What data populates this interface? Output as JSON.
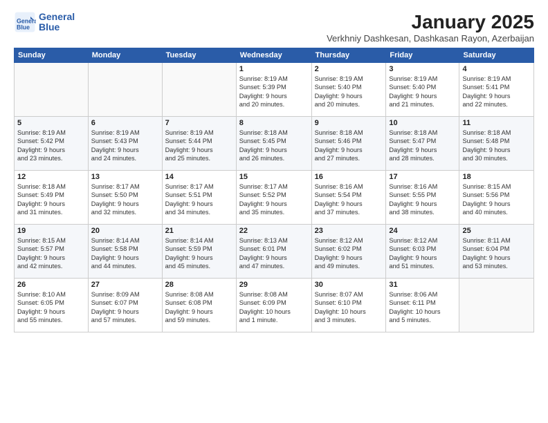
{
  "logo": {
    "line1": "General",
    "line2": "Blue"
  },
  "title": "January 2025",
  "location": "Verkhniy Dashkesan, Dashkasan Rayon, Azerbaijan",
  "weekdays": [
    "Sunday",
    "Monday",
    "Tuesday",
    "Wednesday",
    "Thursday",
    "Friday",
    "Saturday"
  ],
  "weeks": [
    [
      {
        "day": "",
        "info": ""
      },
      {
        "day": "",
        "info": ""
      },
      {
        "day": "",
        "info": ""
      },
      {
        "day": "1",
        "info": "Sunrise: 8:19 AM\nSunset: 5:39 PM\nDaylight: 9 hours\nand 20 minutes."
      },
      {
        "day": "2",
        "info": "Sunrise: 8:19 AM\nSunset: 5:40 PM\nDaylight: 9 hours\nand 20 minutes."
      },
      {
        "day": "3",
        "info": "Sunrise: 8:19 AM\nSunset: 5:40 PM\nDaylight: 9 hours\nand 21 minutes."
      },
      {
        "day": "4",
        "info": "Sunrise: 8:19 AM\nSunset: 5:41 PM\nDaylight: 9 hours\nand 22 minutes."
      }
    ],
    [
      {
        "day": "5",
        "info": "Sunrise: 8:19 AM\nSunset: 5:42 PM\nDaylight: 9 hours\nand 23 minutes."
      },
      {
        "day": "6",
        "info": "Sunrise: 8:19 AM\nSunset: 5:43 PM\nDaylight: 9 hours\nand 24 minutes."
      },
      {
        "day": "7",
        "info": "Sunrise: 8:19 AM\nSunset: 5:44 PM\nDaylight: 9 hours\nand 25 minutes."
      },
      {
        "day": "8",
        "info": "Sunrise: 8:18 AM\nSunset: 5:45 PM\nDaylight: 9 hours\nand 26 minutes."
      },
      {
        "day": "9",
        "info": "Sunrise: 8:18 AM\nSunset: 5:46 PM\nDaylight: 9 hours\nand 27 minutes."
      },
      {
        "day": "10",
        "info": "Sunrise: 8:18 AM\nSunset: 5:47 PM\nDaylight: 9 hours\nand 28 minutes."
      },
      {
        "day": "11",
        "info": "Sunrise: 8:18 AM\nSunset: 5:48 PM\nDaylight: 9 hours\nand 30 minutes."
      }
    ],
    [
      {
        "day": "12",
        "info": "Sunrise: 8:18 AM\nSunset: 5:49 PM\nDaylight: 9 hours\nand 31 minutes."
      },
      {
        "day": "13",
        "info": "Sunrise: 8:17 AM\nSunset: 5:50 PM\nDaylight: 9 hours\nand 32 minutes."
      },
      {
        "day": "14",
        "info": "Sunrise: 8:17 AM\nSunset: 5:51 PM\nDaylight: 9 hours\nand 34 minutes."
      },
      {
        "day": "15",
        "info": "Sunrise: 8:17 AM\nSunset: 5:52 PM\nDaylight: 9 hours\nand 35 minutes."
      },
      {
        "day": "16",
        "info": "Sunrise: 8:16 AM\nSunset: 5:54 PM\nDaylight: 9 hours\nand 37 minutes."
      },
      {
        "day": "17",
        "info": "Sunrise: 8:16 AM\nSunset: 5:55 PM\nDaylight: 9 hours\nand 38 minutes."
      },
      {
        "day": "18",
        "info": "Sunrise: 8:15 AM\nSunset: 5:56 PM\nDaylight: 9 hours\nand 40 minutes."
      }
    ],
    [
      {
        "day": "19",
        "info": "Sunrise: 8:15 AM\nSunset: 5:57 PM\nDaylight: 9 hours\nand 42 minutes."
      },
      {
        "day": "20",
        "info": "Sunrise: 8:14 AM\nSunset: 5:58 PM\nDaylight: 9 hours\nand 44 minutes."
      },
      {
        "day": "21",
        "info": "Sunrise: 8:14 AM\nSunset: 5:59 PM\nDaylight: 9 hours\nand 45 minutes."
      },
      {
        "day": "22",
        "info": "Sunrise: 8:13 AM\nSunset: 6:01 PM\nDaylight: 9 hours\nand 47 minutes."
      },
      {
        "day": "23",
        "info": "Sunrise: 8:12 AM\nSunset: 6:02 PM\nDaylight: 9 hours\nand 49 minutes."
      },
      {
        "day": "24",
        "info": "Sunrise: 8:12 AM\nSunset: 6:03 PM\nDaylight: 9 hours\nand 51 minutes."
      },
      {
        "day": "25",
        "info": "Sunrise: 8:11 AM\nSunset: 6:04 PM\nDaylight: 9 hours\nand 53 minutes."
      }
    ],
    [
      {
        "day": "26",
        "info": "Sunrise: 8:10 AM\nSunset: 6:05 PM\nDaylight: 9 hours\nand 55 minutes."
      },
      {
        "day": "27",
        "info": "Sunrise: 8:09 AM\nSunset: 6:07 PM\nDaylight: 9 hours\nand 57 minutes."
      },
      {
        "day": "28",
        "info": "Sunrise: 8:08 AM\nSunset: 6:08 PM\nDaylight: 9 hours\nand 59 minutes."
      },
      {
        "day": "29",
        "info": "Sunrise: 8:08 AM\nSunset: 6:09 PM\nDaylight: 10 hours\nand 1 minute."
      },
      {
        "day": "30",
        "info": "Sunrise: 8:07 AM\nSunset: 6:10 PM\nDaylight: 10 hours\nand 3 minutes."
      },
      {
        "day": "31",
        "info": "Sunrise: 8:06 AM\nSunset: 6:11 PM\nDaylight: 10 hours\nand 5 minutes."
      },
      {
        "day": "",
        "info": ""
      }
    ]
  ]
}
